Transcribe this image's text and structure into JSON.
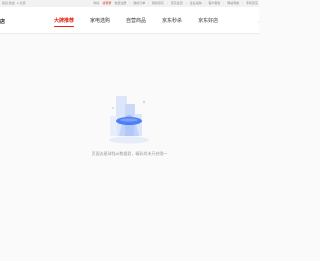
{
  "topbar": {
    "left_text": "您好,欢迎",
    "location": "北京",
    "links": [
      "你好",
      "请登录",
      "免费注册",
      "我的订单",
      "我的京东",
      "京东会员",
      "企业采购",
      "客户服务",
      "网站导航",
      "手机京东"
    ],
    "highlight_index": 1
  },
  "navbar": {
    "logo_fragment": "店",
    "tabs": [
      "大牌推荐",
      "家电选购",
      "自营商品",
      "京东秒杀",
      "京东好店"
    ],
    "active_index": 0,
    "corner": "‹"
  },
  "empty_state": {
    "message": "页面去星球找AI数据君，精彩尚未开启哦～"
  },
  "colors": {
    "accent": "#e1251b",
    "illus_blue": "#4f7ef7",
    "illus_light": "#dce6fb"
  }
}
